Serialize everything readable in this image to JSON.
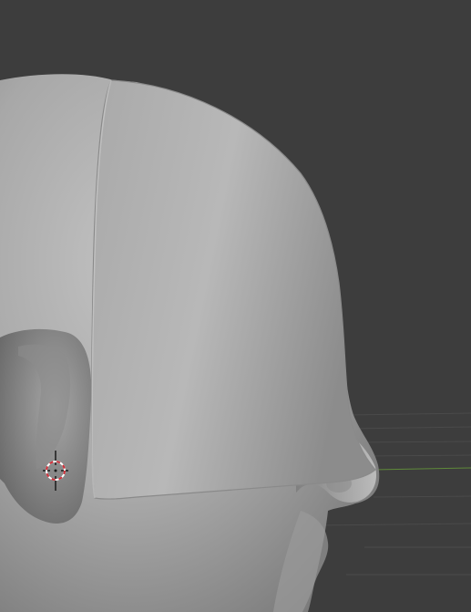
{
  "viewport": {
    "background_color": "#3d3d3d",
    "grid_color": "#4a4a4a",
    "x_axis_color": "#7a5a5a",
    "y_axis_color": "#5f8a3a",
    "mesh_light_color": "#b9b9b9",
    "mesh_mid_color": "#9d9d9d",
    "mesh_dark_color": "#6e6e6e"
  },
  "objects": {
    "head_mesh": "head",
    "helmet_shell": "helmet",
    "cursor_3d": "3d-cursor-icon"
  }
}
